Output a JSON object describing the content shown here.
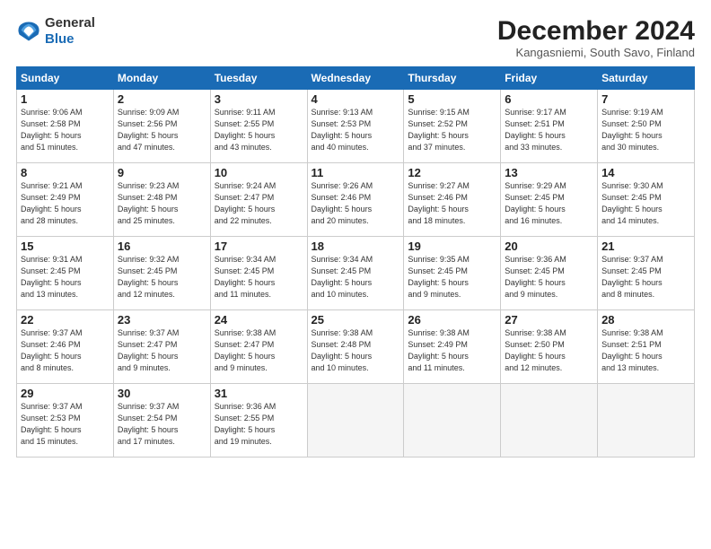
{
  "logo": {
    "general": "General",
    "blue": "Blue"
  },
  "title": "December 2024",
  "subtitle": "Kangasniemi, South Savo, Finland",
  "weekdays": [
    "Sunday",
    "Monday",
    "Tuesday",
    "Wednesday",
    "Thursday",
    "Friday",
    "Saturday"
  ],
  "weeks": [
    [
      {
        "day": "1",
        "info": "Sunrise: 9:06 AM\nSunset: 2:58 PM\nDaylight: 5 hours\nand 51 minutes."
      },
      {
        "day": "2",
        "info": "Sunrise: 9:09 AM\nSunset: 2:56 PM\nDaylight: 5 hours\nand 47 minutes."
      },
      {
        "day": "3",
        "info": "Sunrise: 9:11 AM\nSunset: 2:55 PM\nDaylight: 5 hours\nand 43 minutes."
      },
      {
        "day": "4",
        "info": "Sunrise: 9:13 AM\nSunset: 2:53 PM\nDaylight: 5 hours\nand 40 minutes."
      },
      {
        "day": "5",
        "info": "Sunrise: 9:15 AM\nSunset: 2:52 PM\nDaylight: 5 hours\nand 37 minutes."
      },
      {
        "day": "6",
        "info": "Sunrise: 9:17 AM\nSunset: 2:51 PM\nDaylight: 5 hours\nand 33 minutes."
      },
      {
        "day": "7",
        "info": "Sunrise: 9:19 AM\nSunset: 2:50 PM\nDaylight: 5 hours\nand 30 minutes."
      }
    ],
    [
      {
        "day": "8",
        "info": "Sunrise: 9:21 AM\nSunset: 2:49 PM\nDaylight: 5 hours\nand 28 minutes."
      },
      {
        "day": "9",
        "info": "Sunrise: 9:23 AM\nSunset: 2:48 PM\nDaylight: 5 hours\nand 25 minutes."
      },
      {
        "day": "10",
        "info": "Sunrise: 9:24 AM\nSunset: 2:47 PM\nDaylight: 5 hours\nand 22 minutes."
      },
      {
        "day": "11",
        "info": "Sunrise: 9:26 AM\nSunset: 2:46 PM\nDaylight: 5 hours\nand 20 minutes."
      },
      {
        "day": "12",
        "info": "Sunrise: 9:27 AM\nSunset: 2:46 PM\nDaylight: 5 hours\nand 18 minutes."
      },
      {
        "day": "13",
        "info": "Sunrise: 9:29 AM\nSunset: 2:45 PM\nDaylight: 5 hours\nand 16 minutes."
      },
      {
        "day": "14",
        "info": "Sunrise: 9:30 AM\nSunset: 2:45 PM\nDaylight: 5 hours\nand 14 minutes."
      }
    ],
    [
      {
        "day": "15",
        "info": "Sunrise: 9:31 AM\nSunset: 2:45 PM\nDaylight: 5 hours\nand 13 minutes."
      },
      {
        "day": "16",
        "info": "Sunrise: 9:32 AM\nSunset: 2:45 PM\nDaylight: 5 hours\nand 12 minutes."
      },
      {
        "day": "17",
        "info": "Sunrise: 9:34 AM\nSunset: 2:45 PM\nDaylight: 5 hours\nand 11 minutes."
      },
      {
        "day": "18",
        "info": "Sunrise: 9:34 AM\nSunset: 2:45 PM\nDaylight: 5 hours\nand 10 minutes."
      },
      {
        "day": "19",
        "info": "Sunrise: 9:35 AM\nSunset: 2:45 PM\nDaylight: 5 hours\nand 9 minutes."
      },
      {
        "day": "20",
        "info": "Sunrise: 9:36 AM\nSunset: 2:45 PM\nDaylight: 5 hours\nand 9 minutes."
      },
      {
        "day": "21",
        "info": "Sunrise: 9:37 AM\nSunset: 2:45 PM\nDaylight: 5 hours\nand 8 minutes."
      }
    ],
    [
      {
        "day": "22",
        "info": "Sunrise: 9:37 AM\nSunset: 2:46 PM\nDaylight: 5 hours\nand 8 minutes."
      },
      {
        "day": "23",
        "info": "Sunrise: 9:37 AM\nSunset: 2:47 PM\nDaylight: 5 hours\nand 9 minutes."
      },
      {
        "day": "24",
        "info": "Sunrise: 9:38 AM\nSunset: 2:47 PM\nDaylight: 5 hours\nand 9 minutes."
      },
      {
        "day": "25",
        "info": "Sunrise: 9:38 AM\nSunset: 2:48 PM\nDaylight: 5 hours\nand 10 minutes."
      },
      {
        "day": "26",
        "info": "Sunrise: 9:38 AM\nSunset: 2:49 PM\nDaylight: 5 hours\nand 11 minutes."
      },
      {
        "day": "27",
        "info": "Sunrise: 9:38 AM\nSunset: 2:50 PM\nDaylight: 5 hours\nand 12 minutes."
      },
      {
        "day": "28",
        "info": "Sunrise: 9:38 AM\nSunset: 2:51 PM\nDaylight: 5 hours\nand 13 minutes."
      }
    ],
    [
      {
        "day": "29",
        "info": "Sunrise: 9:37 AM\nSunset: 2:53 PM\nDaylight: 5 hours\nand 15 minutes."
      },
      {
        "day": "30",
        "info": "Sunrise: 9:37 AM\nSunset: 2:54 PM\nDaylight: 5 hours\nand 17 minutes."
      },
      {
        "day": "31",
        "info": "Sunrise: 9:36 AM\nSunset: 2:55 PM\nDaylight: 5 hours\nand 19 minutes."
      },
      {
        "day": "",
        "info": ""
      },
      {
        "day": "",
        "info": ""
      },
      {
        "day": "",
        "info": ""
      },
      {
        "day": "",
        "info": ""
      }
    ]
  ]
}
